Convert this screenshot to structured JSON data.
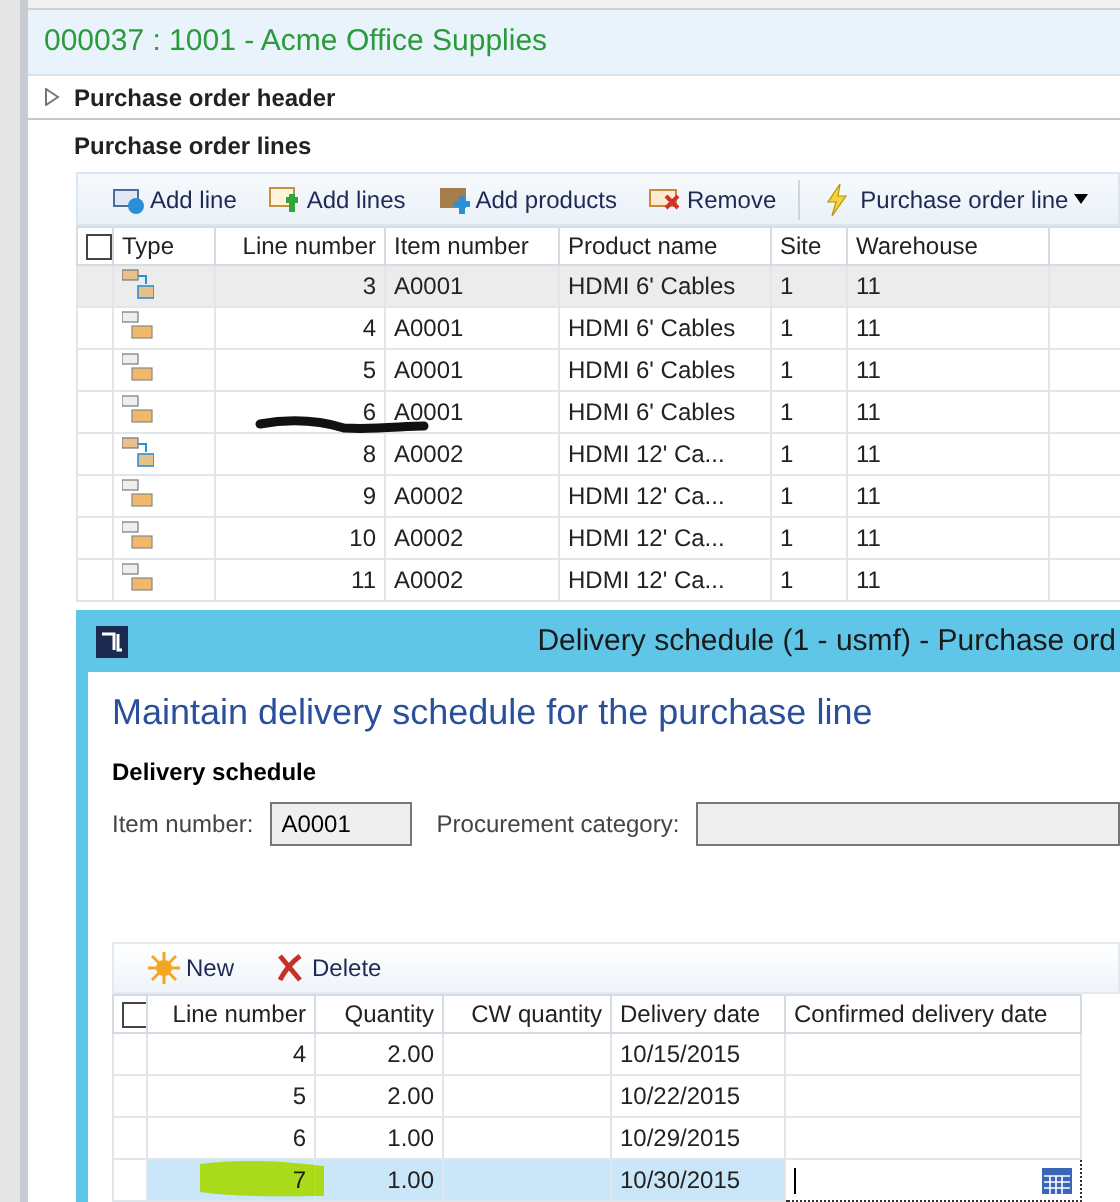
{
  "record_title": "000037 : 1001 - Acme Office Supplies",
  "header_section": {
    "label": "Purchase order header",
    "expanded": false
  },
  "lines_section": {
    "label": "Purchase order lines"
  },
  "toolbar": [
    {
      "kind": "add-line",
      "label": "Add line"
    },
    {
      "kind": "add-lines",
      "label": "Add lines"
    },
    {
      "kind": "add-products",
      "label": "Add products"
    },
    {
      "kind": "remove",
      "label": "Remove"
    },
    {
      "kind": "menu",
      "label": "Purchase order line"
    }
  ],
  "lines_table": {
    "select_all": {
      "checked": false
    },
    "columns": [
      "Type",
      "Line number",
      "Item number",
      "Product name",
      "Site",
      "Warehouse"
    ],
    "rows": [
      {
        "kind": "split",
        "line": "3",
        "item": "A0001",
        "product": "HDMI 6' Cables",
        "site": "1",
        "warehouse": "11",
        "selected": true
      },
      {
        "kind": "line",
        "line": "4",
        "item": "A0001",
        "product": "HDMI 6' Cables",
        "site": "1",
        "warehouse": "11",
        "selected": false
      },
      {
        "kind": "line",
        "line": "5",
        "item": "A0001",
        "product": "HDMI 6' Cables",
        "site": "1",
        "warehouse": "11",
        "selected": false
      },
      {
        "kind": "line",
        "line": "6",
        "item": "A0001",
        "product": "HDMI 6' Cables",
        "site": "1",
        "warehouse": "11",
        "selected": false
      },
      {
        "kind": "split",
        "line": "8",
        "item": "A0002",
        "product": "HDMI 12' Ca...",
        "site": "1",
        "warehouse": "11",
        "selected": false
      },
      {
        "kind": "line",
        "line": "9",
        "item": "A0002",
        "product": "HDMI 12' Ca...",
        "site": "1",
        "warehouse": "11",
        "selected": false
      },
      {
        "kind": "line",
        "line": "10",
        "item": "A0002",
        "product": "HDMI 12' Ca...",
        "site": "1",
        "warehouse": "11",
        "selected": false
      },
      {
        "kind": "line",
        "line": "11",
        "item": "A0002",
        "product": "HDMI 12' Ca...",
        "site": "1",
        "warehouse": "11",
        "selected": false
      }
    ]
  },
  "dialog": {
    "title": "Delivery schedule (1 - usmf) - Purchase ord",
    "heading": "Maintain delivery schedule for the purchase line",
    "group_label": "Delivery schedule",
    "item_number": {
      "label": "Item number:",
      "value": "A0001"
    },
    "procurement_category": {
      "label": "Procurement category:"
    },
    "toolbar": [
      {
        "kind": "new",
        "label": "New"
      },
      {
        "kind": "delete",
        "label": "Delete"
      }
    ],
    "table": {
      "select_all": {
        "checked": false
      },
      "columns": [
        "Line number",
        "Quantity",
        "CW quantity",
        "Delivery date",
        "Confirmed delivery date"
      ],
      "rows": [
        {
          "line": "4",
          "quantity": "2.00",
          "delivery_date": "10/15/2015",
          "selected": false
        },
        {
          "line": "5",
          "quantity": "2.00",
          "delivery_date": "10/22/2015",
          "selected": false
        },
        {
          "line": "6",
          "quantity": "1.00",
          "delivery_date": "10/29/2015",
          "selected": false
        },
        {
          "line": "7",
          "quantity": "1.00",
          "delivery_date": "10/30/2015",
          "selected": true
        }
      ]
    }
  }
}
